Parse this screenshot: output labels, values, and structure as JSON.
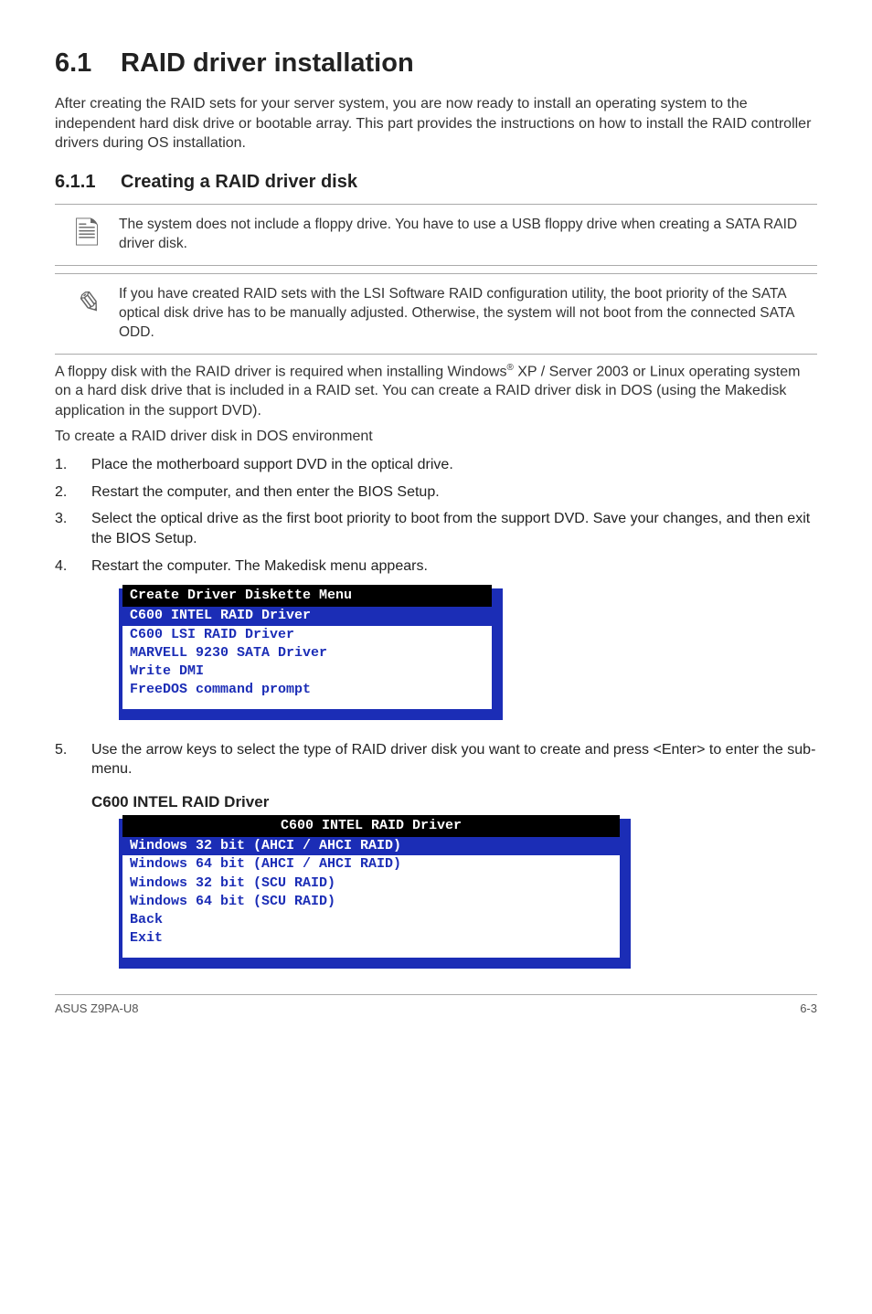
{
  "heading": {
    "number": "6.1",
    "title": "RAID driver installation"
  },
  "intro": "After creating the RAID sets for your server system, you are now ready to install an operating system to the independent hard disk drive or bootable array. This part provides the instructions on how to install the RAID controller drivers during OS installation.",
  "subheading": {
    "number": "6.1.1",
    "title": "Creating a RAID driver disk"
  },
  "notes": [
    "The system does not include a floppy drive. You have to use a USB floppy drive when creating a SATA RAID driver disk.",
    "If you have created RAID sets with the LSI Software RAID configuration utility, the boot priority of the SATA optical disk drive has to be manually adjusted. Otherwise, the system will not boot from the connected SATA ODD."
  ],
  "body1_pre": "A floppy disk with the RAID driver is required when installing Windows",
  "body1_sup": "®",
  "body1_post": " XP / Server 2003 or Linux operating system on a hard disk drive that is included in a RAID set. You can create a RAID driver disk in DOS (using the Makedisk application in the support DVD).",
  "body2": "To create a RAID driver disk in DOS environment",
  "steps": [
    {
      "n": "1.",
      "t": "Place the motherboard support DVD in the optical drive."
    },
    {
      "n": "2.",
      "t": "Restart the computer, and then enter the BIOS Setup."
    },
    {
      "n": "3.",
      "t": "Select the optical drive as the first boot priority to boot from the support DVD. Save your changes, and then exit the BIOS Setup."
    },
    {
      "n": "4.",
      "t": "Restart the computer. The Makedisk menu appears."
    }
  ],
  "console1": {
    "title": "Create Driver Diskette Menu",
    "items": [
      {
        "label": "C600 INTEL RAID Driver",
        "selected": true
      },
      {
        "label": "C600 LSI RAID Driver",
        "selected": false
      },
      {
        "label": "MARVELL 9230 SATA Driver",
        "selected": false
      },
      {
        "label": "Write DMI",
        "selected": false
      },
      {
        "label": "FreeDOS command prompt",
        "selected": false
      }
    ]
  },
  "step5": {
    "n": "5.",
    "t": "Use the arrow keys to select the type of RAID driver disk you want to create and press <Enter> to enter the sub-menu."
  },
  "subheading2": "C600 INTEL RAID Driver",
  "console2": {
    "title": "C600 INTEL RAID Driver",
    "items": [
      {
        "label": "Windows 32 bit (AHCI / AHCI RAID)",
        "selected": true
      },
      {
        "label": "Windows 64 bit (AHCI / AHCI RAID)",
        "selected": false
      },
      {
        "label": "Windows 32 bit (SCU RAID)",
        "selected": false
      },
      {
        "label": "Windows 64 bit (SCU RAID)",
        "selected": false
      },
      {
        "label": "Back",
        "selected": false
      },
      {
        "label": "Exit",
        "selected": false
      }
    ]
  },
  "footer": {
    "left": "ASUS Z9PA-U8",
    "right": "6-3"
  }
}
